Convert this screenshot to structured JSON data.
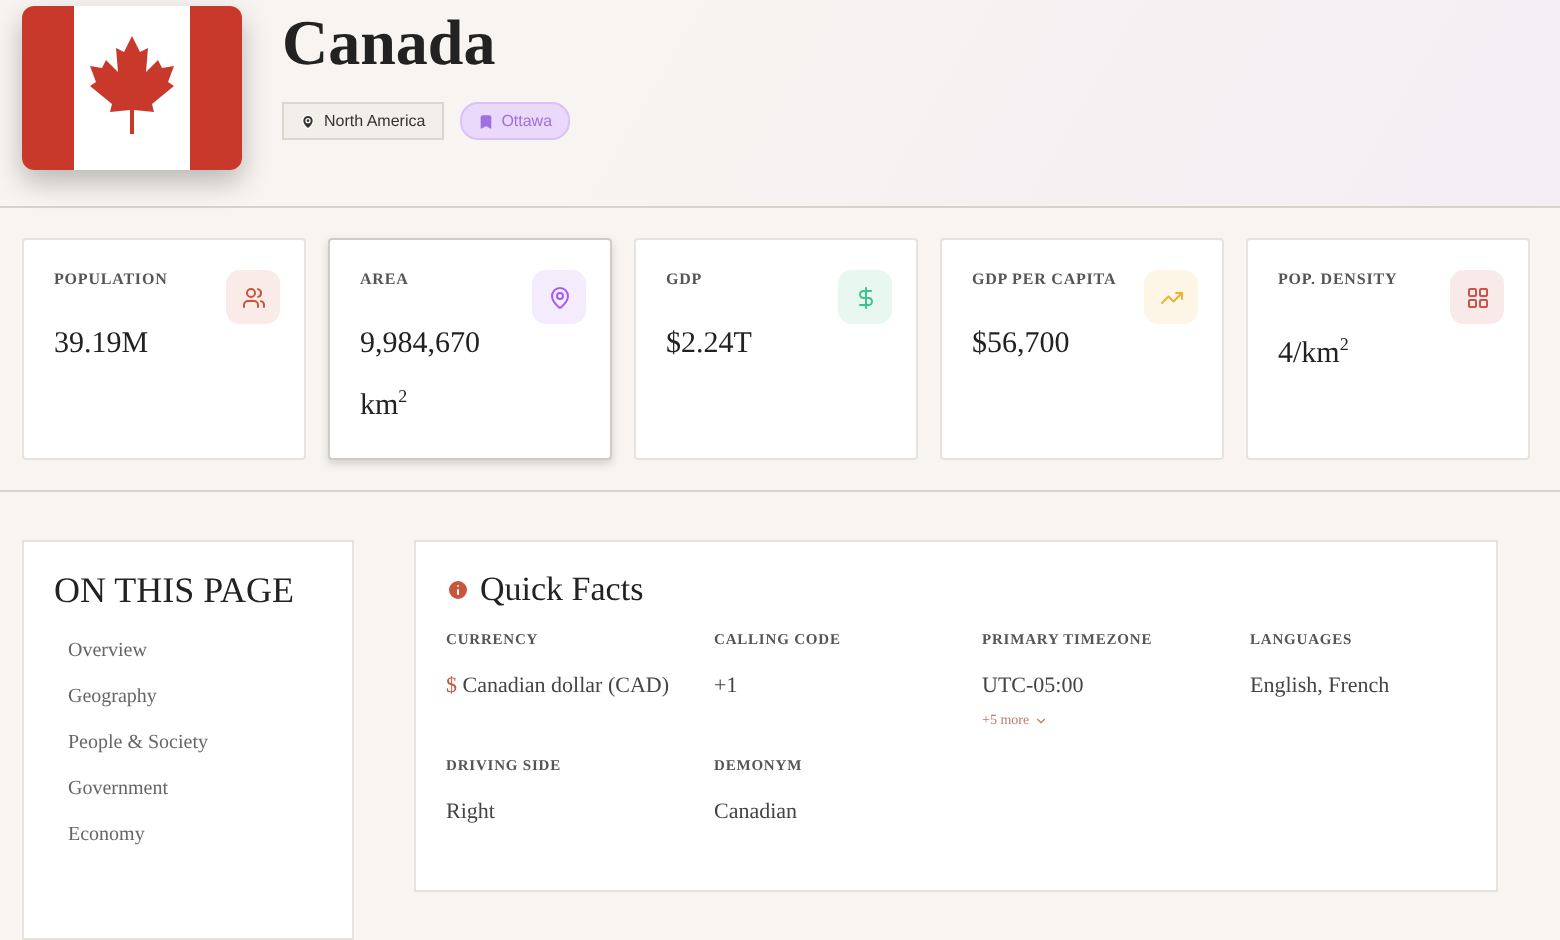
{
  "country": {
    "name": "Canada",
    "region": "North America",
    "capital": "Ottawa"
  },
  "stats": [
    {
      "label": "POPULATION",
      "value": "39.19M",
      "kind": "people",
      "color": "#c8553d",
      "selected": false
    },
    {
      "label": "AREA",
      "value": "9,984,670 km$^{2}$",
      "kind": "pin",
      "color": "#a35bf0",
      "selected": true
    },
    {
      "label": "GDP",
      "value": "$2.24T",
      "kind": "dollar",
      "color": "#3cc48a",
      "selected": false
    },
    {
      "label": "GDP PER CAPITA",
      "value": "$56,700",
      "kind": "trend",
      "color": "#f0b030",
      "selected": false
    },
    {
      "label": "POP. DENSITY",
      "value": "4/km$^{2}$",
      "kind": "grid",
      "color": "#d0504a",
      "selected": false
    }
  ],
  "toc": {
    "title": "ON THIS PAGE",
    "items": [
      "Overview",
      "Geography",
      "People & Society",
      "Government",
      "Economy"
    ]
  },
  "quick_facts": {
    "title": "Quick Facts",
    "facts": [
      {
        "label": "CURRENCY",
        "symbol": "$",
        "value": "Canadian dollar (CAD)"
      },
      {
        "label": "CALLING CODE",
        "value": "+1"
      },
      {
        "label": "PRIMARY TIMEZONE",
        "value": "UTC-05:00",
        "more": "+5 more"
      },
      {
        "label": "LANGUAGES",
        "value": "English, French"
      },
      {
        "label": "DRIVING SIDE",
        "value": "Right"
      },
      {
        "label": "DEMONYM",
        "value": "Canadian"
      }
    ]
  }
}
